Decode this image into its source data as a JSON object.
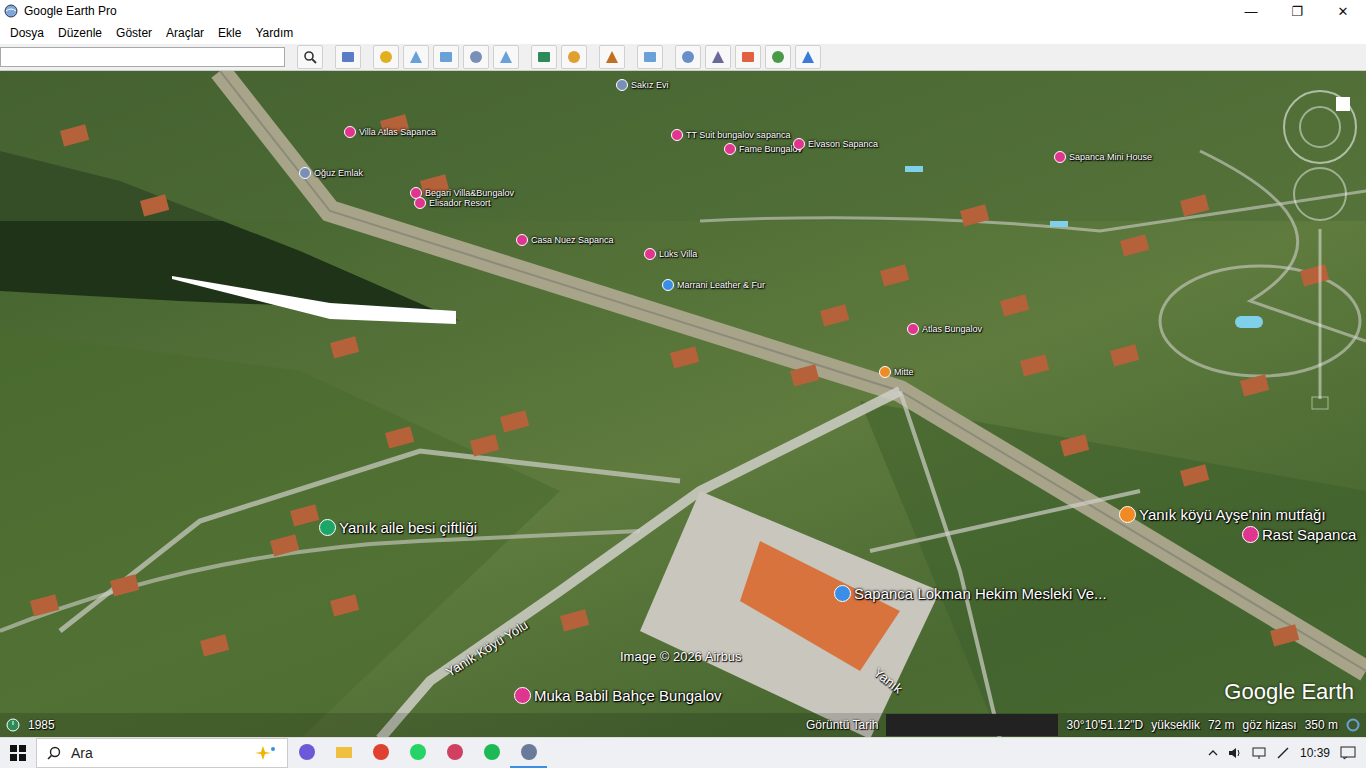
{
  "window": {
    "title": "Google Earth Pro",
    "controls": [
      "—",
      "❐",
      "✕"
    ]
  },
  "menu": [
    {
      "label": "Dosya"
    },
    {
      "label": "Düzenle"
    },
    {
      "label": "Göster"
    },
    {
      "label": "Araçlar"
    },
    {
      "label": "Ekle"
    },
    {
      "label": "Yardım"
    }
  ],
  "search": {
    "value": ""
  },
  "map": {
    "pins": [
      {
        "label": "Sakız Evi",
        "color": "#7a8fb8",
        "kind": "small"
      },
      {
        "label": "Villa Atlas Sapanca",
        "color": "#e0358f",
        "kind": "small"
      },
      {
        "label": "Oğuz Emlak",
        "color": "#7a8fb8",
        "kind": "small"
      },
      {
        "label": "Begari Villa&Bungalov",
        "color": "#e0358f",
        "kind": "small"
      },
      {
        "label": "Elisador Resort",
        "color": "#e0358f",
        "kind": "small"
      },
      {
        "label": "TT Suit bungalov sapanca",
        "color": "#e0358f",
        "kind": "small"
      },
      {
        "label": "Fame Bungalov",
        "color": "#e0358f",
        "kind": "small"
      },
      {
        "label": "Elvason Sapanca",
        "color": "#e0358f",
        "kind": "small"
      },
      {
        "label": "Sapanca Mini House",
        "color": "#e0358f",
        "kind": "small"
      },
      {
        "label": "Casa Nuez Sapanca",
        "color": "#e0358f",
        "kind": "small"
      },
      {
        "label": "Lüks Villa",
        "color": "#e0358f",
        "kind": "small"
      },
      {
        "label": "Marrani Leather & Fur",
        "color": "#3a8ee6",
        "kind": "small"
      },
      {
        "label": "Atlas Bungalov",
        "color": "#e0358f",
        "kind": "small"
      },
      {
        "label": "Mitte",
        "color": "#f08a24",
        "kind": "small"
      },
      {
        "label": "Yanık aile besi çiftliği",
        "color": "#1ea66a",
        "kind": "large"
      },
      {
        "label": "Yanık köyü Ayşe'nin mutfağı",
        "color": "#f08a24",
        "kind": "large"
      },
      {
        "label": "Rast Sapanca",
        "color": "#e0358f",
        "kind": "large"
      },
      {
        "label": "Sapanca Lokman Hekim Mesleki Ve...",
        "color": "#3a8ee6",
        "kind": "large"
      },
      {
        "label": "Muka Babil Bahçe Bungalov",
        "color": "#e0358f",
        "kind": "large"
      }
    ],
    "road_labels": [
      {
        "label": "Yanık Köyü Yolu"
      },
      {
        "label": "Yanık"
      }
    ],
    "attribution": "Image © 2026 Airbus",
    "logo": "Google Earth"
  },
  "status_bar": {
    "year": "1985",
    "date_label": "Görüntü Tarih",
    "coords": "30°10'51.12\"D",
    "elevation_label": "yükseklik",
    "elevation": "72 m",
    "eye_label": "göz hizası",
    "eye": "350 m"
  },
  "taskbar": {
    "search": "Ara",
    "time": "10:39"
  }
}
